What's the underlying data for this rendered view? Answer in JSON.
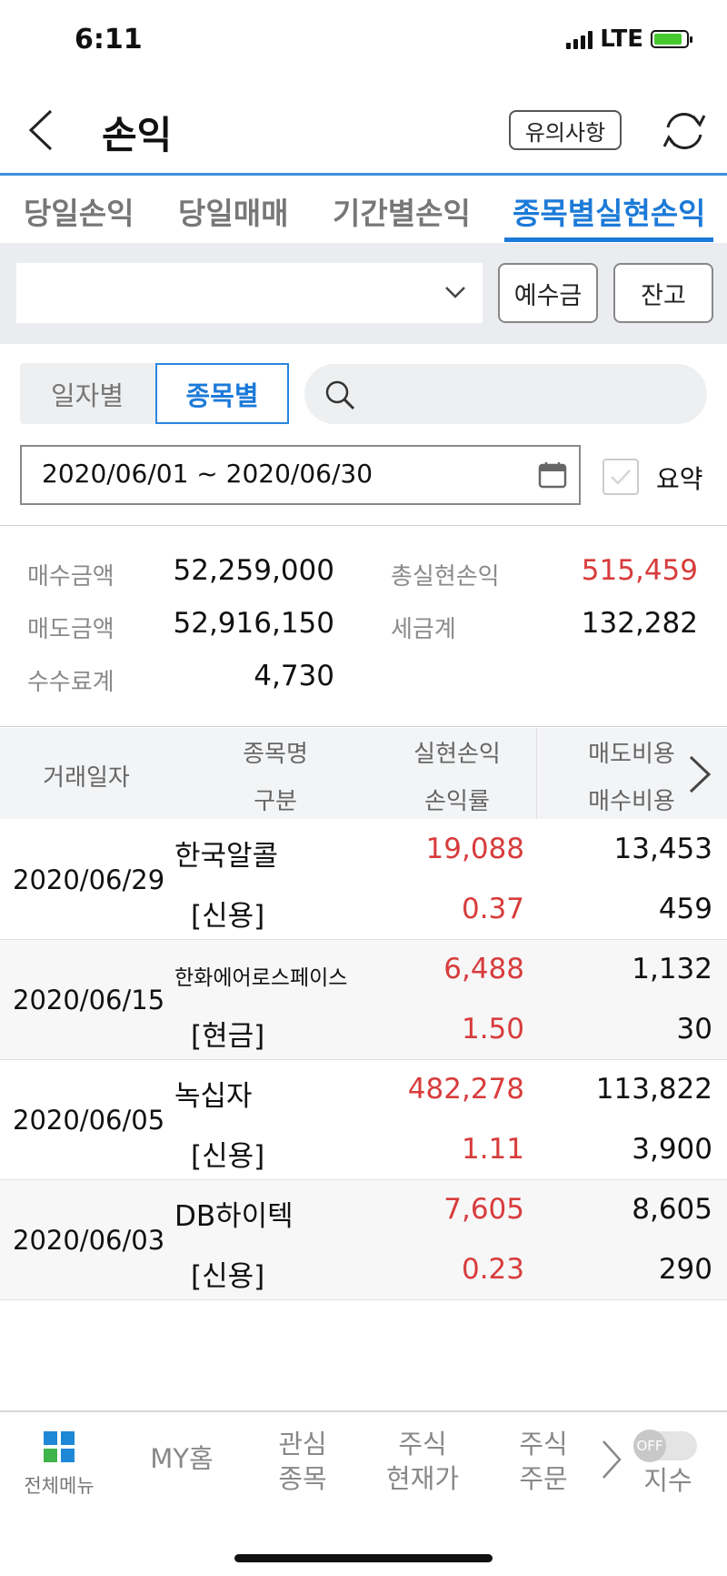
{
  "status_bar": {
    "time": "6:11",
    "network": "LTE"
  },
  "header": {
    "title": "손익",
    "notice_button": "유의사항"
  },
  "tabs": [
    {
      "label": "당일손익",
      "active": false
    },
    {
      "label": "당일매매",
      "active": false
    },
    {
      "label": "기간별손익",
      "active": false
    },
    {
      "label": "종목별실현손익",
      "active": true
    }
  ],
  "account": {
    "deposit_button": "예수금",
    "balance_button": "잔고"
  },
  "filters": {
    "segments": [
      {
        "label": "일자별",
        "active": false
      },
      {
        "label": "종목별",
        "active": true
      }
    ],
    "search_placeholder": "",
    "date_range": "2020/06/01 ~ 2020/06/30",
    "summary_label": "요약"
  },
  "summary": {
    "buy_amount_label": "매수금액",
    "buy_amount": "52,259,000",
    "sell_amount_label": "매도금액",
    "sell_amount": "52,916,150",
    "fee_label": "수수료계",
    "fee": "4,730",
    "total_pnl_label": "총실현손익",
    "total_pnl": "515,459",
    "tax_label": "세금계",
    "tax": "132,282"
  },
  "table": {
    "headers": {
      "date": "거래일자",
      "name": "종목명",
      "type": "구분",
      "pnl": "실현손익",
      "rate": "손익률",
      "sell_cost": "매도비용",
      "buy_cost": "매수비용"
    },
    "rows": [
      {
        "date": "2020/06/29",
        "name": "한국알콜",
        "type": "[신용]",
        "pnl": "19,088",
        "rate": "0.37",
        "sell_cost": "13,453",
        "buy_cost": "459"
      },
      {
        "date": "2020/06/15",
        "name": "한화에어로스페이스",
        "type": "[현금]",
        "pnl": "6,488",
        "rate": "1.50",
        "sell_cost": "1,132",
        "buy_cost": "30"
      },
      {
        "date": "2020/06/05",
        "name": "녹십자",
        "type": "[신용]",
        "pnl": "482,278",
        "rate": "1.11",
        "sell_cost": "113,822",
        "buy_cost": "3,900"
      },
      {
        "date": "2020/06/03",
        "name": "DB하이텍",
        "type": "[신용]",
        "pnl": "7,605",
        "rate": "0.23",
        "sell_cost": "8,605",
        "buy_cost": "290"
      }
    ]
  },
  "bottom_nav": {
    "all_menu": "전체메뉴",
    "my_home": "MY홈",
    "watchlist_1": "관심",
    "watchlist_2": "종목",
    "stock_price_1": "주식",
    "stock_price_2": "현재가",
    "stock_order_1": "주식",
    "stock_order_2": "주문",
    "toggle_label": "OFF",
    "index": "지수"
  },
  "colors": {
    "accent": "#1c7ad8",
    "profit": "#d83c3c",
    "grid_blue": "#1e88d6",
    "grid_green": "#3fb44a"
  }
}
